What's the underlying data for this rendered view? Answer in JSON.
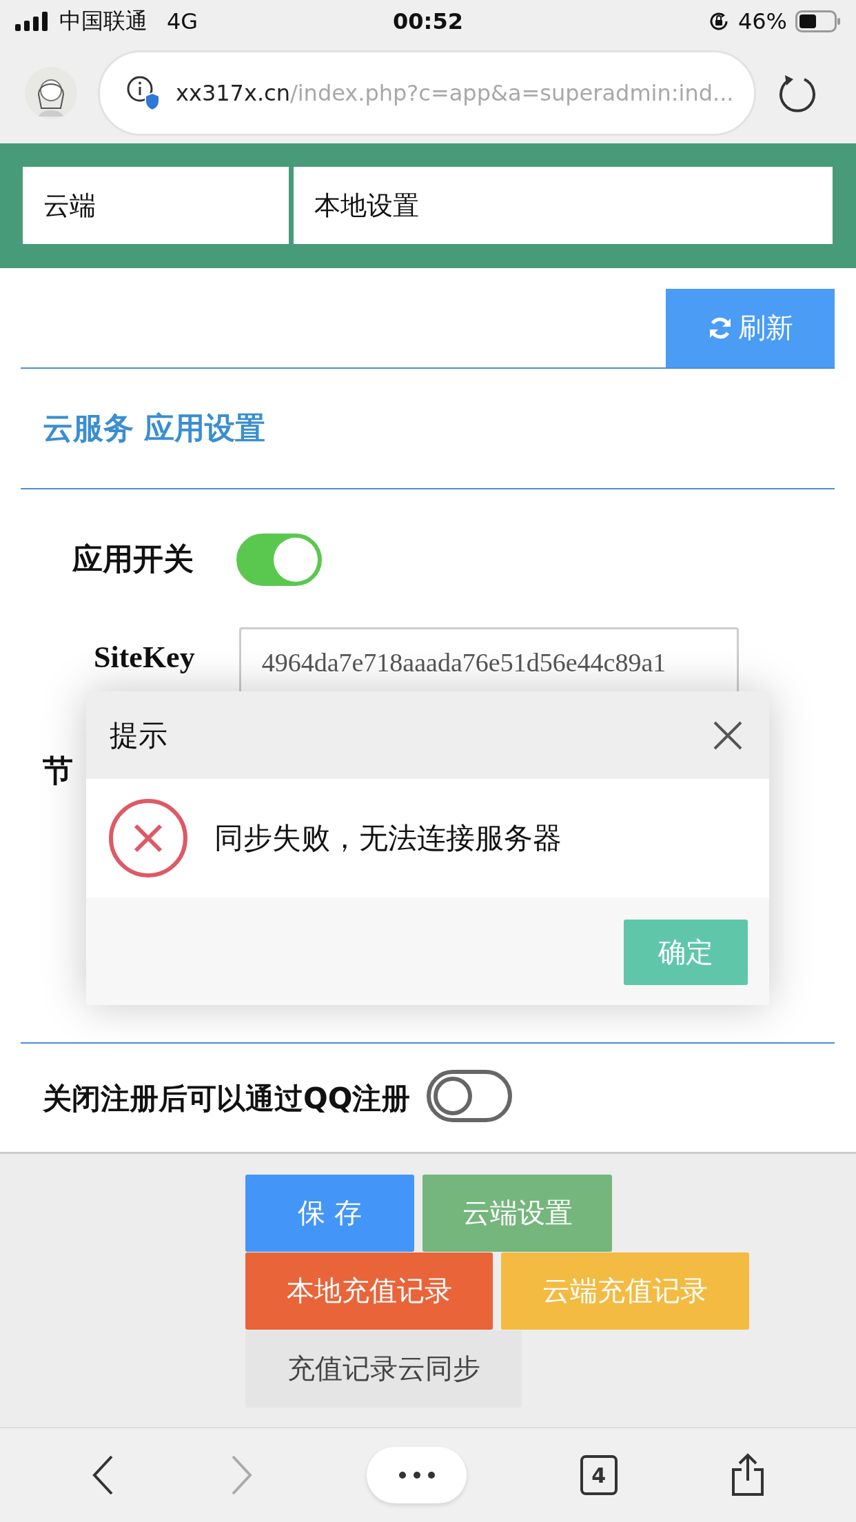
{
  "status_bar": {
    "carrier": "中国联通",
    "network": "4G",
    "time": "00:52",
    "battery": "46%"
  },
  "browser": {
    "url_host": "xx317x.cn",
    "url_path": "/index.php?c=app&a=superadmin:ind..."
  },
  "tabs": [
    {
      "label": "云端"
    },
    {
      "label": "本地设置"
    }
  ],
  "refresh_button": "刷新",
  "section_title": "云服务 应用设置",
  "settings": [
    {
      "kind": "toggle",
      "label": "应用开关",
      "on": true
    },
    {
      "kind": "text",
      "label": "SiteKey",
      "value": "4964da7e718aaada76e51d56e44c89a1"
    },
    {
      "kind": "label",
      "label": "节"
    }
  ],
  "register_toggle": {
    "label": "关闭注册后可以通过QQ注册",
    "on": false
  },
  "dialog": {
    "title": "提示",
    "message": "同步失败，无法连接服务器",
    "confirm": "确定"
  },
  "actions": [
    {
      "label": "保 存",
      "color": "#4495f8"
    },
    {
      "label": "云端设置",
      "color": "#75b67d"
    },
    {
      "label": "本地充值记录",
      "color": "#ea643a"
    },
    {
      "label": "云端充值记录",
      "color": "#f3bb42"
    },
    {
      "label": "充值记录云同步",
      "color": "#e5e5e5"
    }
  ],
  "toolbar": {
    "tab_count": "4"
  }
}
